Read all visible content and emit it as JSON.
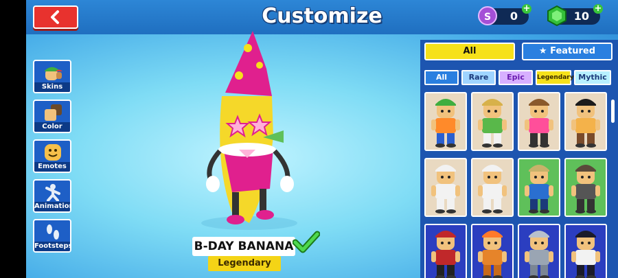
{
  "header": {
    "title": "Customize",
    "coins": "0",
    "gems": "10",
    "coin_symbol": "S"
  },
  "sidebar": {
    "items": [
      {
        "label": "Skins"
      },
      {
        "label": "Color"
      },
      {
        "label": "Emotes"
      },
      {
        "label": "Animations"
      },
      {
        "label": "Footsteps"
      }
    ]
  },
  "character": {
    "name": "B-DAY BANANA",
    "rarity": "Legendary"
  },
  "panel": {
    "tabs": [
      {
        "label": "All"
      },
      {
        "label": "Featured"
      }
    ],
    "filters": [
      {
        "label": "All"
      },
      {
        "label": "Rare"
      },
      {
        "label": "Epic"
      },
      {
        "label": "Legendary"
      },
      {
        "label": "Mythic"
      }
    ],
    "skins": [
      {
        "rarity": "common",
        "hair": "#3fae3f",
        "shirt": "#ff8a2a",
        "pants": "#2a5fd0"
      },
      {
        "rarity": "common",
        "hair": "#d7b14a",
        "shirt": "#59b84a",
        "pants": "#f2f2f2"
      },
      {
        "rarity": "common",
        "hair": "#8a5a2b",
        "shirt": "#ff4f9a",
        "pants": "#333333"
      },
      {
        "rarity": "common",
        "hair": "#1b1b1b",
        "shirt": "#f4b24a",
        "pants": "#7a4b2a"
      },
      {
        "rarity": "common",
        "hair": "#f2f2f2",
        "shirt": "#f2f2f2",
        "pants": "#f2f2f2"
      },
      {
        "rarity": "common",
        "hair": "#f2f2f2",
        "shirt": "#f2f2f2",
        "pants": "#f2f2f2"
      },
      {
        "rarity": "rare",
        "hair": "#c8b26a",
        "shirt": "#2a6fd0",
        "pants": "#1b3a7a"
      },
      {
        "rarity": "rare",
        "hair": "#5a4a3a",
        "shirt": "#555555",
        "pants": "#333333"
      },
      {
        "rarity": "epic",
        "hair": "#c0282a",
        "shirt": "#c0282a",
        "pants": "#222222"
      },
      {
        "rarity": "epic",
        "hair": "#ff7a2a",
        "shirt": "#e6842a",
        "pants": "#c86a1a"
      },
      {
        "rarity": "epic",
        "hair": "#b7c0cc",
        "shirt": "#9aa5b3",
        "pants": "#7a8594"
      },
      {
        "rarity": "epic",
        "hair": "#1b1b2a",
        "shirt": "#f2f2f2",
        "pants": "#1b1b2a"
      }
    ]
  },
  "colors": {
    "common": "#e9d9c1",
    "rare": "#5fc05a",
    "epic": "#2b3ec0",
    "allTab": "#f6e11a",
    "featuredTab": "#2a7fe0"
  }
}
